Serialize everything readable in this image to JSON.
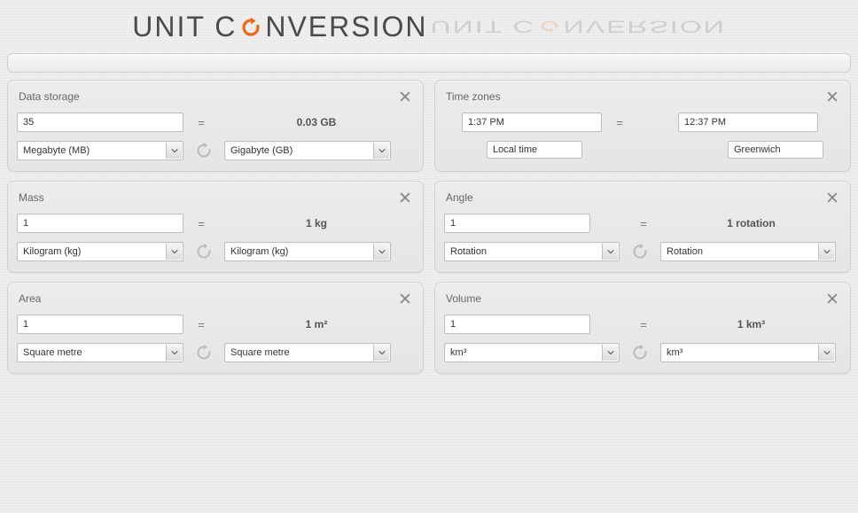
{
  "title": {
    "left": "UNIT C",
    "right": "NVERSION"
  },
  "panels": {
    "data_storage": {
      "title": "Data storage",
      "value": "35",
      "result": "0.03 GB",
      "from_unit": "Megabyte (MB)",
      "to_unit": "Gigabyte (GB)"
    },
    "time_zones": {
      "title": "Time zones",
      "from_time": "1:37 PM",
      "to_time": "12:37 PM",
      "from_label": "Local time",
      "to_label": "Greenwich"
    },
    "mass": {
      "title": "Mass",
      "value": "1",
      "result": "1 kg",
      "from_unit": "Kilogram (kg)",
      "to_unit": "Kilogram (kg)"
    },
    "angle": {
      "title": "Angle",
      "value": "1",
      "result": "1 rotation",
      "from_unit": "Rotation",
      "to_unit": "Rotation"
    },
    "area": {
      "title": "Area",
      "value": "1",
      "result": "1 m²",
      "from_unit": "Square metre",
      "to_unit": "Square metre"
    },
    "volume": {
      "title": "Volume",
      "value": "1",
      "result": "1 km³",
      "from_unit": "km³",
      "to_unit": "km³"
    }
  },
  "equals": "="
}
